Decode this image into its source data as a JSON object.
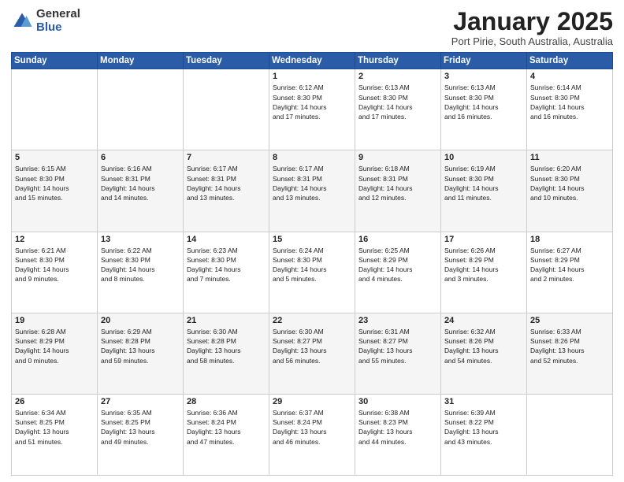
{
  "logo": {
    "general": "General",
    "blue": "Blue"
  },
  "title": "January 2025",
  "subtitle": "Port Pirie, South Australia, Australia",
  "days_of_week": [
    "Sunday",
    "Monday",
    "Tuesday",
    "Wednesday",
    "Thursday",
    "Friday",
    "Saturday"
  ],
  "weeks": [
    [
      {
        "day": "",
        "info": ""
      },
      {
        "day": "",
        "info": ""
      },
      {
        "day": "",
        "info": ""
      },
      {
        "day": "1",
        "info": "Sunrise: 6:12 AM\nSunset: 8:30 PM\nDaylight: 14 hours\nand 17 minutes."
      },
      {
        "day": "2",
        "info": "Sunrise: 6:13 AM\nSunset: 8:30 PM\nDaylight: 14 hours\nand 17 minutes."
      },
      {
        "day": "3",
        "info": "Sunrise: 6:13 AM\nSunset: 8:30 PM\nDaylight: 14 hours\nand 16 minutes."
      },
      {
        "day": "4",
        "info": "Sunrise: 6:14 AM\nSunset: 8:30 PM\nDaylight: 14 hours\nand 16 minutes."
      }
    ],
    [
      {
        "day": "5",
        "info": "Sunrise: 6:15 AM\nSunset: 8:30 PM\nDaylight: 14 hours\nand 15 minutes."
      },
      {
        "day": "6",
        "info": "Sunrise: 6:16 AM\nSunset: 8:31 PM\nDaylight: 14 hours\nand 14 minutes."
      },
      {
        "day": "7",
        "info": "Sunrise: 6:17 AM\nSunset: 8:31 PM\nDaylight: 14 hours\nand 13 minutes."
      },
      {
        "day": "8",
        "info": "Sunrise: 6:17 AM\nSunset: 8:31 PM\nDaylight: 14 hours\nand 13 minutes."
      },
      {
        "day": "9",
        "info": "Sunrise: 6:18 AM\nSunset: 8:31 PM\nDaylight: 14 hours\nand 12 minutes."
      },
      {
        "day": "10",
        "info": "Sunrise: 6:19 AM\nSunset: 8:30 PM\nDaylight: 14 hours\nand 11 minutes."
      },
      {
        "day": "11",
        "info": "Sunrise: 6:20 AM\nSunset: 8:30 PM\nDaylight: 14 hours\nand 10 minutes."
      }
    ],
    [
      {
        "day": "12",
        "info": "Sunrise: 6:21 AM\nSunset: 8:30 PM\nDaylight: 14 hours\nand 9 minutes."
      },
      {
        "day": "13",
        "info": "Sunrise: 6:22 AM\nSunset: 8:30 PM\nDaylight: 14 hours\nand 8 minutes."
      },
      {
        "day": "14",
        "info": "Sunrise: 6:23 AM\nSunset: 8:30 PM\nDaylight: 14 hours\nand 7 minutes."
      },
      {
        "day": "15",
        "info": "Sunrise: 6:24 AM\nSunset: 8:30 PM\nDaylight: 14 hours\nand 5 minutes."
      },
      {
        "day": "16",
        "info": "Sunrise: 6:25 AM\nSunset: 8:29 PM\nDaylight: 14 hours\nand 4 minutes."
      },
      {
        "day": "17",
        "info": "Sunrise: 6:26 AM\nSunset: 8:29 PM\nDaylight: 14 hours\nand 3 minutes."
      },
      {
        "day": "18",
        "info": "Sunrise: 6:27 AM\nSunset: 8:29 PM\nDaylight: 14 hours\nand 2 minutes."
      }
    ],
    [
      {
        "day": "19",
        "info": "Sunrise: 6:28 AM\nSunset: 8:29 PM\nDaylight: 14 hours\nand 0 minutes."
      },
      {
        "day": "20",
        "info": "Sunrise: 6:29 AM\nSunset: 8:28 PM\nDaylight: 13 hours\nand 59 minutes."
      },
      {
        "day": "21",
        "info": "Sunrise: 6:30 AM\nSunset: 8:28 PM\nDaylight: 13 hours\nand 58 minutes."
      },
      {
        "day": "22",
        "info": "Sunrise: 6:30 AM\nSunset: 8:27 PM\nDaylight: 13 hours\nand 56 minutes."
      },
      {
        "day": "23",
        "info": "Sunrise: 6:31 AM\nSunset: 8:27 PM\nDaylight: 13 hours\nand 55 minutes."
      },
      {
        "day": "24",
        "info": "Sunrise: 6:32 AM\nSunset: 8:26 PM\nDaylight: 13 hours\nand 54 minutes."
      },
      {
        "day": "25",
        "info": "Sunrise: 6:33 AM\nSunset: 8:26 PM\nDaylight: 13 hours\nand 52 minutes."
      }
    ],
    [
      {
        "day": "26",
        "info": "Sunrise: 6:34 AM\nSunset: 8:25 PM\nDaylight: 13 hours\nand 51 minutes."
      },
      {
        "day": "27",
        "info": "Sunrise: 6:35 AM\nSunset: 8:25 PM\nDaylight: 13 hours\nand 49 minutes."
      },
      {
        "day": "28",
        "info": "Sunrise: 6:36 AM\nSunset: 8:24 PM\nDaylight: 13 hours\nand 47 minutes."
      },
      {
        "day": "29",
        "info": "Sunrise: 6:37 AM\nSunset: 8:24 PM\nDaylight: 13 hours\nand 46 minutes."
      },
      {
        "day": "30",
        "info": "Sunrise: 6:38 AM\nSunset: 8:23 PM\nDaylight: 13 hours\nand 44 minutes."
      },
      {
        "day": "31",
        "info": "Sunrise: 6:39 AM\nSunset: 8:22 PM\nDaylight: 13 hours\nand 43 minutes."
      },
      {
        "day": "",
        "info": ""
      }
    ]
  ]
}
